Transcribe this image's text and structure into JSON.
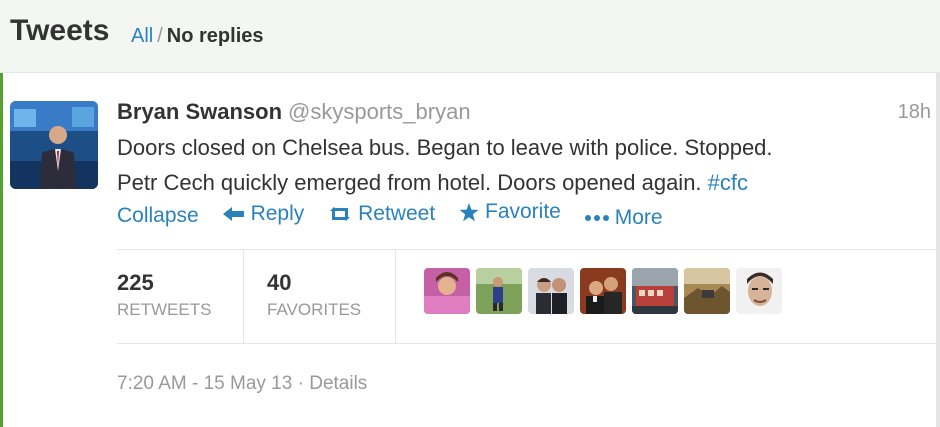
{
  "header": {
    "title": "Tweets",
    "filter_all": "All",
    "separator": "/",
    "filter_no_replies": "No replies"
  },
  "tweet": {
    "full_name": "Bryan Swanson",
    "username": "@skysports_bryan",
    "time_ago": "18h",
    "text_line1": "Doors closed on Chelsea bus. Began to leave with police. Stopped.",
    "text_line2": "Petr Cech quickly emerged from hotel. Doors opened again.",
    "hashtag": "#cfc",
    "actions": {
      "collapse": "Collapse",
      "reply": "Reply",
      "retweet": "Retweet",
      "favorite": "Favorite",
      "more": "More"
    },
    "stats": {
      "retweets_count": "225",
      "retweets_label": "RETWEETS",
      "favorites_count": "40",
      "favorites_label": "FAVORITES"
    },
    "timestamp": "7:20 AM - 15 May 13",
    "meta_separator": "·",
    "details": "Details"
  },
  "colors": {
    "link": "#2a82bd",
    "muted": "#999999",
    "text": "#333333"
  },
  "icons": [
    "reply-arrow-icon",
    "retweet-icon",
    "star-icon",
    "ellipsis-icon"
  ]
}
